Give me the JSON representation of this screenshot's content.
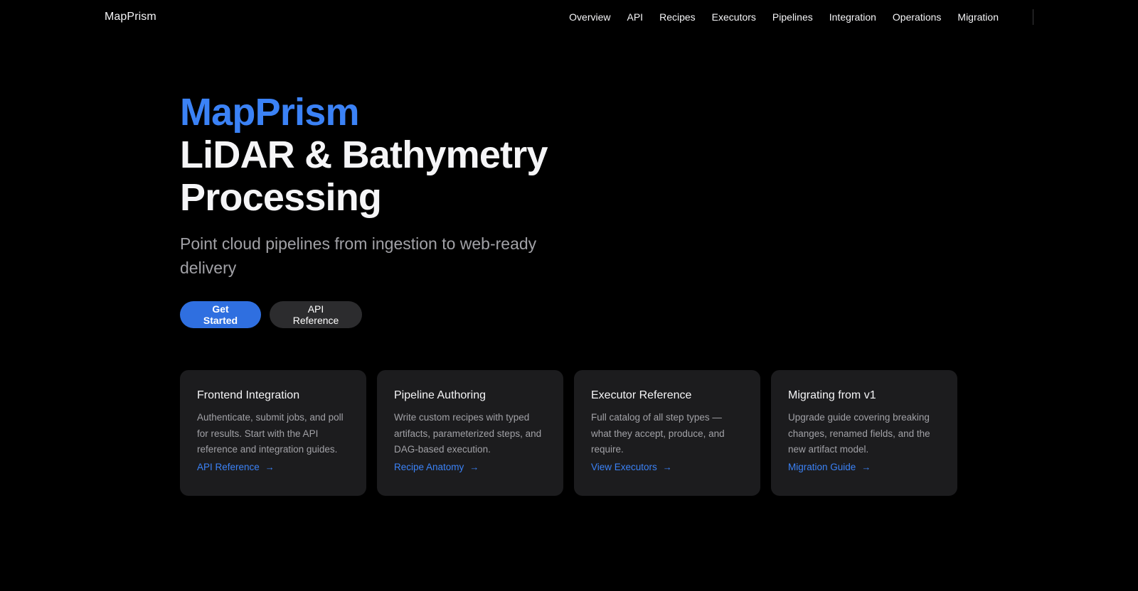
{
  "nav": {
    "brand": "MapPrism",
    "links": [
      "Overview",
      "API",
      "Recipes",
      "Executors",
      "Pipelines",
      "Integration",
      "Operations",
      "Migration"
    ]
  },
  "hero": {
    "brand": "MapPrism",
    "title_line1": "LiDAR & Bathymetry",
    "title_line2": "Processing",
    "subtitle": "Point cloud pipelines from ingestion to web-ready delivery",
    "primary_button": "Get Started",
    "secondary_button": "API Reference"
  },
  "cards": [
    {
      "title": "Frontend Integration",
      "description": "Authenticate, submit jobs, and poll for results. Start with the API reference and integration guides.",
      "link": "API Reference"
    },
    {
      "title": "Pipeline Authoring",
      "description": "Write custom recipes with typed artifacts, parameterized steps, and DAG-based execution.",
      "link": "Recipe Anatomy"
    },
    {
      "title": "Executor Reference",
      "description": "Full catalog of all step types — what they accept, produce, and require.",
      "link": "View Executors"
    },
    {
      "title": "Migrating from v1",
      "description": "Upgrade guide covering breaking changes, renamed fields, and the new artifact model.",
      "link": "Migration Guide"
    }
  ],
  "colors": {
    "background": "#000000",
    "accent": "#3b82f6",
    "primary_button": "#2f6fe0",
    "card_background": "#1c1c1e"
  },
  "icons": {
    "card_link_arrow": "arrow-right-icon"
  }
}
